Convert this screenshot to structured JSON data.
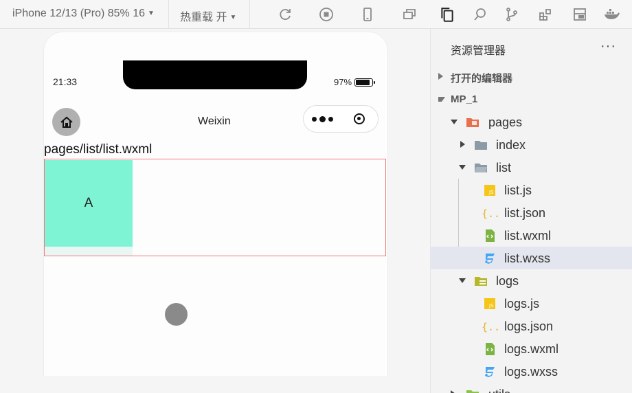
{
  "toolbar": {
    "device_label": "iPhone 12/13 (Pro) 85% 16",
    "hot_reload_label": "热重载 开",
    "icons": [
      "refresh-icon",
      "stop-icon",
      "phone-icon",
      "window-icon",
      "copy-icon",
      "search-icon",
      "branch-icon",
      "extensions-icon",
      "layout-icon",
      "docker-icon"
    ]
  },
  "simulator": {
    "status_time": "21:33",
    "battery_percent": "97%",
    "nav_title": "Weixin",
    "page_path": "pages/list/list.wxml",
    "box_label": "A"
  },
  "explorer": {
    "title": "资源管理器",
    "more": "···",
    "open_editors_label": "打开的编辑器",
    "project_label": "MP_1",
    "items": [
      {
        "label": "pages"
      },
      {
        "label": "index"
      },
      {
        "label": "list"
      },
      {
        "label": "list.js",
        "icon": "js-file-icon"
      },
      {
        "label": "list.json",
        "icon": "json-file-icon"
      },
      {
        "label": "list.wxml",
        "icon": "wxml-file-icon"
      },
      {
        "label": "list.wxss",
        "icon": "wxss-file-icon",
        "selected": true
      },
      {
        "label": "logs"
      },
      {
        "label": "logs.js",
        "icon": "js-file-icon"
      },
      {
        "label": "logs.json",
        "icon": "json-file-icon"
      },
      {
        "label": "logs.wxml",
        "icon": "wxml-file-icon"
      },
      {
        "label": "logs.wxss",
        "icon": "wxss-file-icon"
      },
      {
        "label": "utils"
      }
    ]
  }
}
